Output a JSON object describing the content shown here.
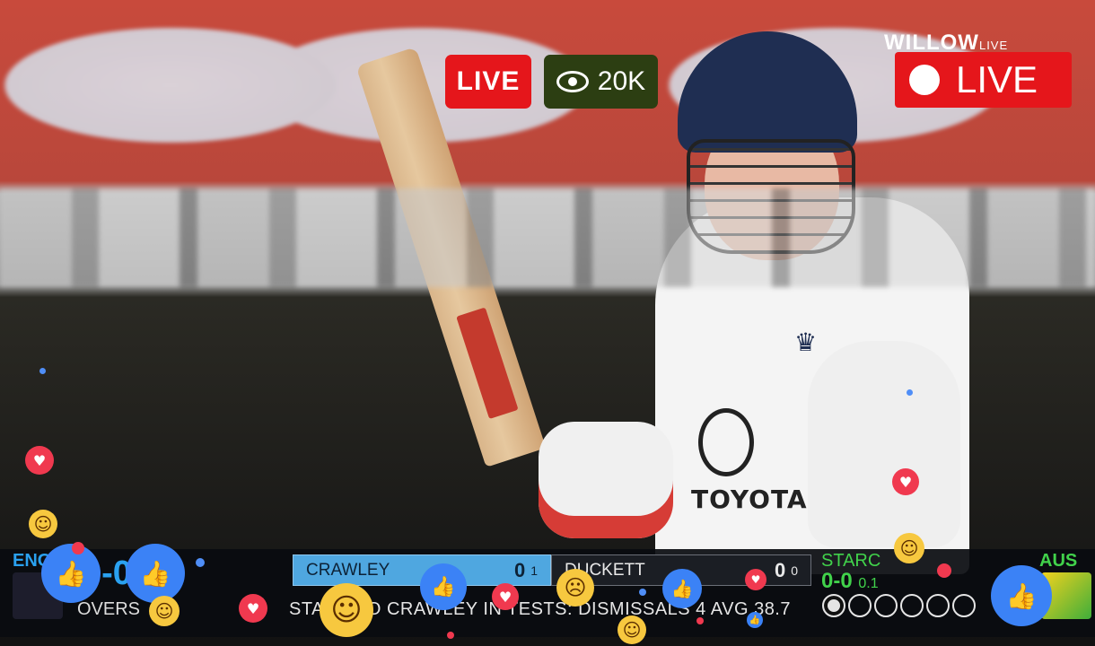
{
  "overlay": {
    "live_label": "LIVE",
    "viewers": "20K",
    "broadcaster": "WILLOW",
    "broadcaster_suffix": "LIVE",
    "corner_live": "LIVE"
  },
  "player_kit": {
    "sponsor": "TOYOTA"
  },
  "scoreboard": {
    "team_left": "ENG",
    "score_left": "0-0",
    "overs_label": "OVERS",
    "batter1": {
      "name": "CRAWLEY",
      "runs": "0",
      "balls": "1"
    },
    "batter2": {
      "name": "DUCKETT",
      "runs": "0",
      "balls": "0"
    },
    "ticker": "STARC TO CRAWLEY IN TESTS: DISMISSALS 4 AVG 38.7",
    "bowler": {
      "name": "STARC",
      "figures": "0-0",
      "overs": "0.1"
    },
    "this_over": [
      "•",
      "",
      "",
      "",
      "",
      ""
    ],
    "team_right": "AUS"
  },
  "reactions": [
    "like-icon",
    "heart-icon",
    "haha-icon",
    "wow-icon"
  ],
  "colors": {
    "live_red": "#e5161b",
    "eng_blue": "#2aa1f0",
    "aus_green": "#41d24b",
    "viewer_badge": "#2c3e12"
  }
}
